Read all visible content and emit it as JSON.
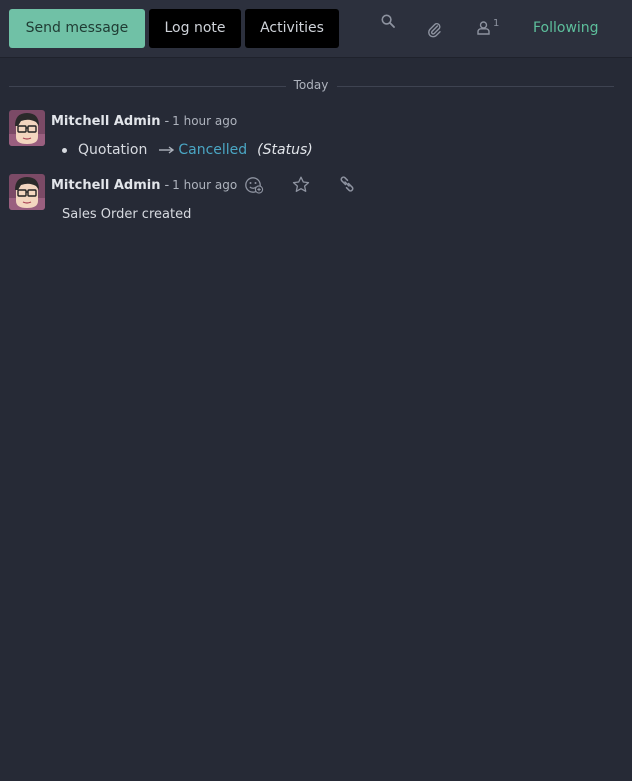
{
  "chatter": {
    "send_message_label": "Send message",
    "log_note_label": "Log note",
    "activities_label": "Activities",
    "follower_count": "1",
    "following_label": "Following"
  },
  "separator": {
    "label": "Today"
  },
  "messages": [
    {
      "author": "Mitchell Admin",
      "dash": "-",
      "date": "1 hour ago",
      "tracking": {
        "old_value": "Quotation",
        "new_value": "Cancelled",
        "field": "(Status)"
      }
    },
    {
      "author": "Mitchell Admin",
      "dash": "-",
      "date": "1 hour ago",
      "body": "Sales Order created"
    }
  ],
  "icons": {
    "search": "search-icon",
    "attachment": "paperclip-icon",
    "followers": "user-icon",
    "reaction": "add-reaction-icon",
    "star": "star-icon",
    "link": "link-icon"
  }
}
